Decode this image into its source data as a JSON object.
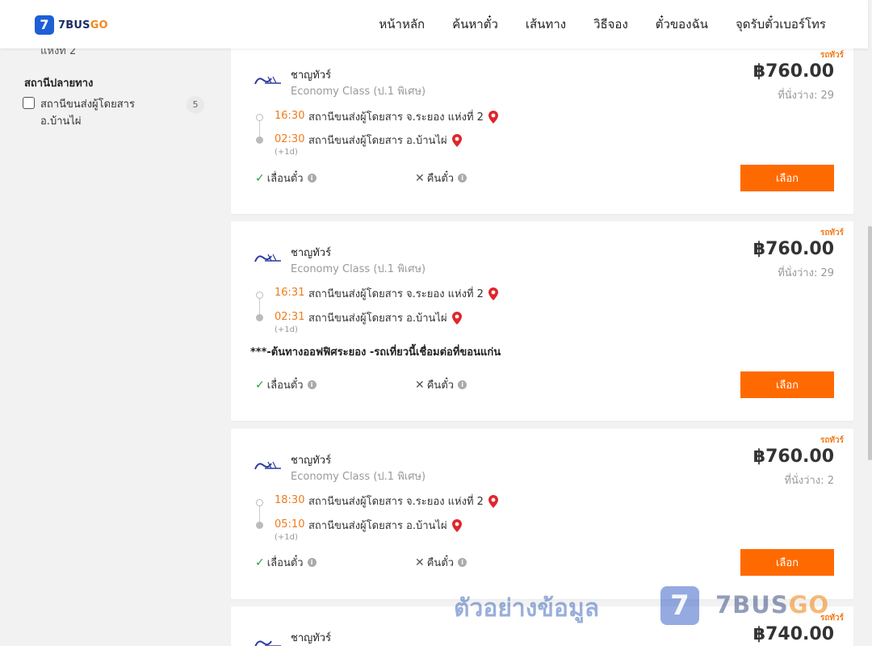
{
  "header": {
    "logo_mark": "7",
    "logo_text_main": "7BUS",
    "logo_text_accent": "GO",
    "nav": [
      "หน้าหลัก",
      "ค้นหาตั๋ว",
      "เส้นทาง",
      "วิธีจอง",
      "ตั๋วของฉัน",
      "จุดรับตั๋วเบอร์โทร"
    ]
  },
  "sidebar": {
    "clipped_text": "แห่งที่ 2",
    "section_title": "สถานีปลายทาง",
    "option_label": "สถานีขนส่งผู้โดยสาร อ.บ้านไผ่",
    "option_count": "5",
    "option_checked": false
  },
  "trips": [
    {
      "tag": "รถทัวร์",
      "operator": "ชาญทัวร์",
      "class": "Economy Class (ป.1 พิเศษ)",
      "price": "฿760.00",
      "seats": "ที่นั่งว่าง: 29",
      "dep_time": "16:30",
      "dep_station": "สถานีขนส่งผู้โดยสาร จ.ระยอง แห่งที่ 2",
      "arr_time": "02:30",
      "arr_station": "สถานีขนส่งผู้โดยสาร อ.บ้านไผ่",
      "next_day": "(+1d)",
      "note": "",
      "reschedule": "เลื่อนตั๋ว",
      "refund": "คืนตั๋ว",
      "select": "เลือก"
    },
    {
      "tag": "รถทัวร์",
      "operator": "ชาญทัวร์",
      "class": "Economy Class (ป.1 พิเศษ)",
      "price": "฿760.00",
      "seats": "ที่นั่งว่าง: 29",
      "dep_time": "16:31",
      "dep_station": "สถานีขนส่งผู้โดยสาร จ.ระยอง แห่งที่ 2",
      "arr_time": "02:31",
      "arr_station": "สถานีขนส่งผู้โดยสาร อ.บ้านไผ่",
      "next_day": "(+1d)",
      "note": "***-ต้นทางออฟฟิศระยอง -รถเที่ยวนี้เชื่อมต่อที่ขอนแก่น",
      "reschedule": "เลื่อนตั๋ว",
      "refund": "คืนตั๋ว",
      "select": "เลือก"
    },
    {
      "tag": "รถทัวร์",
      "operator": "ชาญทัวร์",
      "class": "Economy Class (ป.1 พิเศษ)",
      "price": "฿760.00",
      "seats": "ที่นั่งว่าง: 2",
      "dep_time": "18:30",
      "dep_station": "สถานีขนส่งผู้โดยสาร จ.ระยอง แห่งที่ 2",
      "arr_time": "05:10",
      "arr_station": "สถานีขนส่งผู้โดยสาร อ.บ้านไผ่",
      "next_day": "(+1d)",
      "note": "",
      "reschedule": "เลื่อนตั๋ว",
      "refund": "คืนตั๋ว",
      "select": "เลือก"
    },
    {
      "tag": "รถทัวร์",
      "operator": "ชาญทัวร์",
      "price": "฿740.00"
    }
  ],
  "watermark": {
    "text": "ตัวอย่างข้อมูล",
    "logo_mark": "7",
    "brand_main": "7BUS",
    "brand_accent": "GO"
  },
  "colors": {
    "accent_orange": "#ff6a00",
    "time_orange": "#f07a1a",
    "brand_blue": "#1e5fd6",
    "check_green": "#2a9d3a",
    "pin_red": "#e0262b"
  }
}
